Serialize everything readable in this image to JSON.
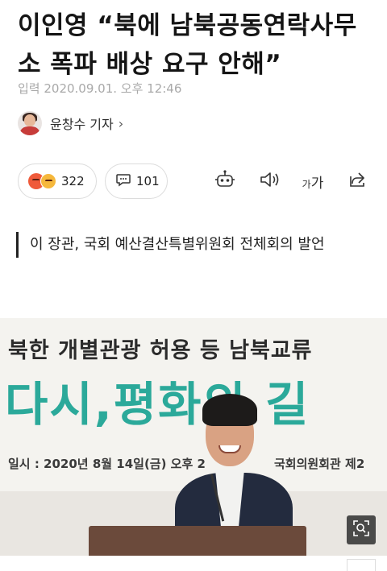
{
  "article": {
    "headline": "이인영 “북에 남북공동연락사무소 폭파 배상 요구 안해”",
    "meta": "입력 2020.09.01. 오후 12:46",
    "author": "윤창수 기자",
    "author_chevron": "›"
  },
  "actions": {
    "reaction_count": "322",
    "comment_count": "101",
    "font_size_label_small": "가",
    "font_size_label_large": "가"
  },
  "summary": {
    "text": "이 장관, 국회 예산결산특별위원회 전체회의 발언"
  },
  "photo": {
    "banner_line1": "북한 개별관광 허용 등 남북교류",
    "banner_line2": "다시,평화의 길",
    "banner_line3": "일시 : 2020년 8월 14일(금) 오후 2",
    "banner_line4": "국회의원회관 제2"
  },
  "colors": {
    "accent_teal": "#2ba99a",
    "angry_red": "#ef5a3a",
    "sad_yellow": "#f6b83c"
  },
  "icons": [
    "comment-icon",
    "robot-icon",
    "speaker-icon",
    "share-icon",
    "zoom-icon"
  ]
}
